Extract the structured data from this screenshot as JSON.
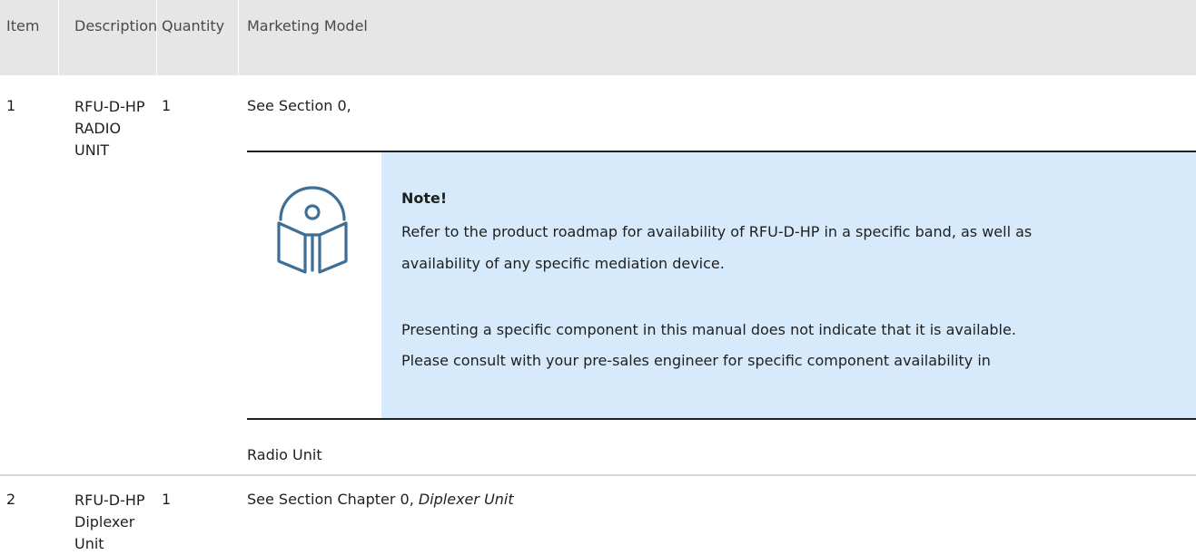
{
  "table": {
    "headers": {
      "item": "Item",
      "description": "Description",
      "quantity": "Quantity",
      "marketing_model": "Marketing Model"
    },
    "rows": [
      {
        "item": "1",
        "description": "RFU-D-HP RADIO UNIT",
        "quantity": "1",
        "model_text": "See Section 0,",
        "model_after": "Radio Unit"
      },
      {
        "item": "2",
        "description": "RFU-D-HP Diplexer Unit",
        "quantity": "1",
        "model_text": "See Section Chapter 0, ",
        "model_italic": "Diplexer Unit"
      }
    ]
  },
  "note": {
    "icon": "book-info-icon",
    "title": "Note!",
    "line1": "Refer to the product roadmap for availability of RFU-D-HP in a specific band, as well as",
    "line2": "availability of any specific mediation device.",
    "line3": "Presenting a specific component in this manual does not indicate that it is available.",
    "line4": "Please consult with your pre-sales engineer for specific component availability in"
  },
  "colors": {
    "header_bg": "#e6e6e6",
    "note_bg": "#d6eafc",
    "icon_color": "#3f6f96"
  }
}
